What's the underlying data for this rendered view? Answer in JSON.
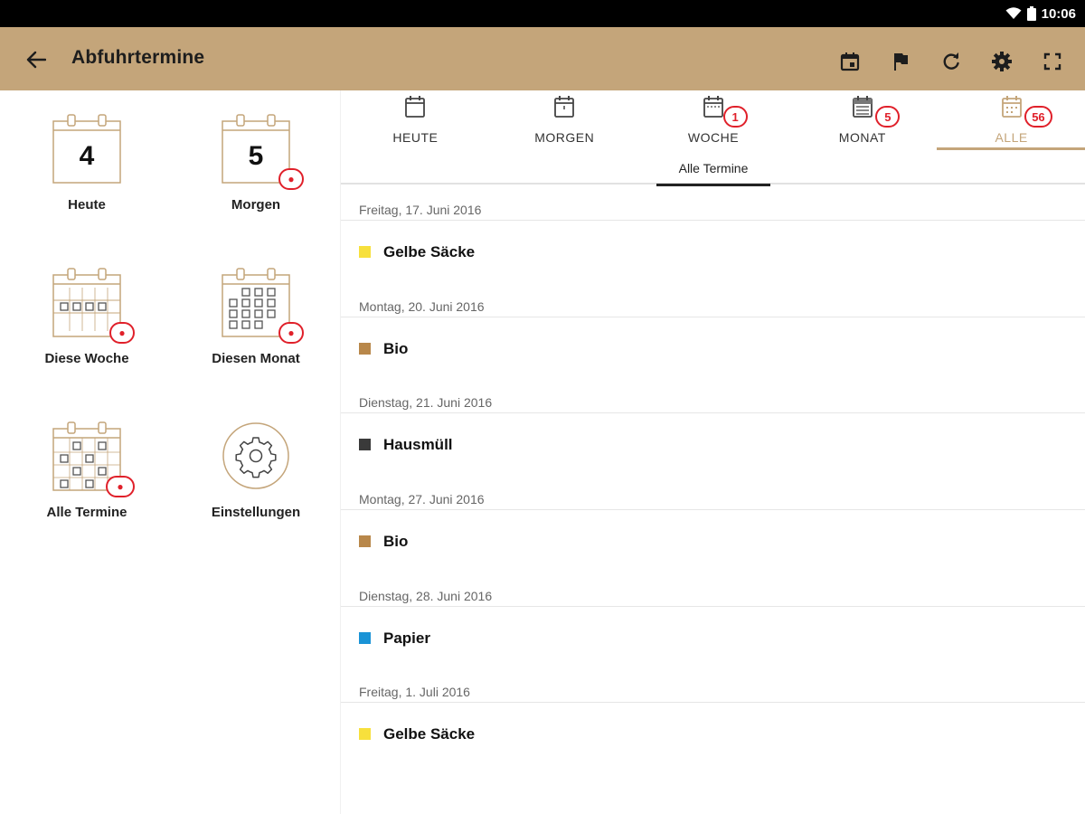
{
  "status_bar": {
    "time": "10:06",
    "icons": [
      "wifi-icon",
      "battery-icon"
    ]
  },
  "app_bar": {
    "title": "Abfuhrtermine",
    "back_icon": "arrow-left-icon",
    "actions": [
      "calendar-event-icon",
      "flag-icon",
      "refresh-icon",
      "settings-icon",
      "fullscreen-icon"
    ]
  },
  "colors": {
    "accent": "#c4a57a",
    "badge": "#e0202a",
    "appbar": "#c4a57a"
  },
  "grid": {
    "today": {
      "label": "Heute",
      "day": "4"
    },
    "tomorrow": {
      "label": "Morgen",
      "day": "5"
    },
    "week": {
      "label": "Diese Woche"
    },
    "month": {
      "label": "Diesen Monat"
    },
    "all": {
      "label": "Alle Termine"
    },
    "settings": {
      "label": "Einstellungen"
    }
  },
  "tabs": [
    {
      "label": "HEUTE",
      "badge": ""
    },
    {
      "label": "MORGEN",
      "badge": ""
    },
    {
      "label": "WOCHE",
      "badge": "1"
    },
    {
      "label": "MONAT",
      "badge": "5"
    },
    {
      "label": "ALLE",
      "badge": "56"
    }
  ],
  "active_tab": "ALLE",
  "subtab": {
    "label": "Alle Termine"
  },
  "entries": [
    {
      "date": "Freitag, 17. Juni 2016",
      "label": "Gelbe Säcke",
      "color": "#f7e03c"
    },
    {
      "date": "Montag, 20. Juni 2016",
      "label": "Bio",
      "color": "#b8874a"
    },
    {
      "date": "Dienstag, 21. Juni 2016",
      "label": "Hausmüll",
      "color": "#3a3a3a"
    },
    {
      "date": "Montag, 27. Juni 2016",
      "label": "Bio",
      "color": "#b8874a"
    },
    {
      "date": "Dienstag, 28. Juni 2016",
      "label": "Papier",
      "color": "#1a93d6"
    },
    {
      "date": "Freitag, 1. Juli 2016",
      "label": "Gelbe Säcke",
      "color": "#f7e03c"
    }
  ]
}
